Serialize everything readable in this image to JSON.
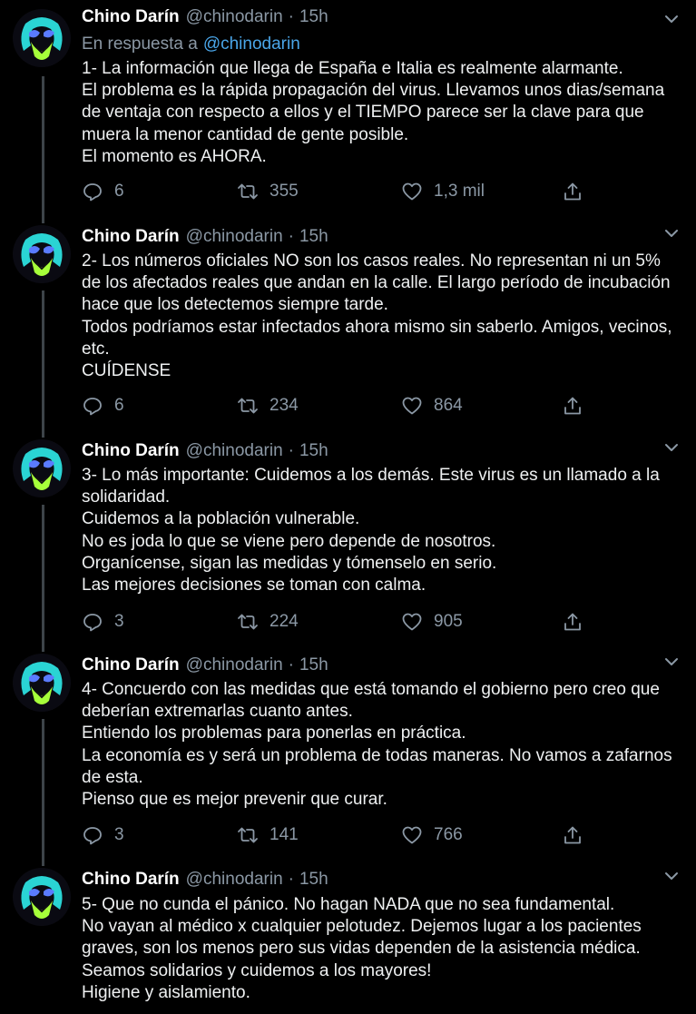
{
  "tweets": [
    {
      "name": "Chino Darín",
      "handle": "@chinodarin",
      "time": "15h",
      "reply_label": "En respuesta a",
      "reply_mention": "@chinodarin",
      "text": "1- La información que llega de España e Italia es realmente alarmante.\nEl problema es la rápida propagación del virus. Llevamos unos dias/semana de ventaja con respecto a ellos y el TIEMPO parece ser la clave para que muera la menor cantidad de gente posible.\nEl momento es AHORA.",
      "replies": "6",
      "retweets": "355",
      "likes": "1,3 mil"
    },
    {
      "name": "Chino Darín",
      "handle": "@chinodarin",
      "time": "15h",
      "text": "2- Los números oficiales NO son los casos reales. No representan ni un 5% de los afectados reales que andan en la calle. El largo período de incubación hace que los detectemos siempre tarde.\nTodos podríamos estar infectados ahora mismo sin saberlo. Amigos, vecinos, etc.\nCUÍDENSE",
      "replies": "6",
      "retweets": "234",
      "likes": "864"
    },
    {
      "name": "Chino Darín",
      "handle": "@chinodarin",
      "time": "15h",
      "text": "3- Lo más importante: Cuidemos a los demás. Este virus es un llamado a la solidaridad.\nCuidemos a la población vulnerable.\nNo es joda lo que se viene pero depende de nosotros.\nOrganícense, sigan las medidas y tómenselo en serio.\nLas mejores decisiones se toman con calma.",
      "replies": "3",
      "retweets": "224",
      "likes": "905"
    },
    {
      "name": "Chino Darín",
      "handle": "@chinodarin",
      "time": "15h",
      "text": "4- Concuerdo con las medidas que está tomando el gobierno pero creo que deberían extremarlas cuanto antes.\nEntiendo los problemas para ponerlas en práctica.\nLa economía es y será un problema de todas maneras. No vamos a zafarnos de esta.\nPienso que es mejor prevenir que curar.",
      "replies": "3",
      "retweets": "141",
      "likes": "766"
    },
    {
      "name": "Chino Darín",
      "handle": "@chinodarin",
      "time": "15h",
      "text": "5- Que no cunda el pánico. No hagan NADA que no sea fundamental.\nNo vayan al médico x cualquier pelotudez. Dejemos lugar a los pacientes graves, son los menos pero sus vidas dependen de la asistencia médica. Seamos solidarios y cuidemos a los mayores!\nHigiene y aislamiento."
    }
  ],
  "icons": {
    "reply": "reply-icon",
    "retweet": "retweet-icon",
    "like": "heart-icon",
    "share": "share-icon",
    "menu": "chevron-down-icon"
  },
  "colors": {
    "background": "#000000",
    "text": "#eef0f1",
    "muted": "#8b98a5",
    "link": "#4aa6e9",
    "thread_line": "#3d4449"
  }
}
